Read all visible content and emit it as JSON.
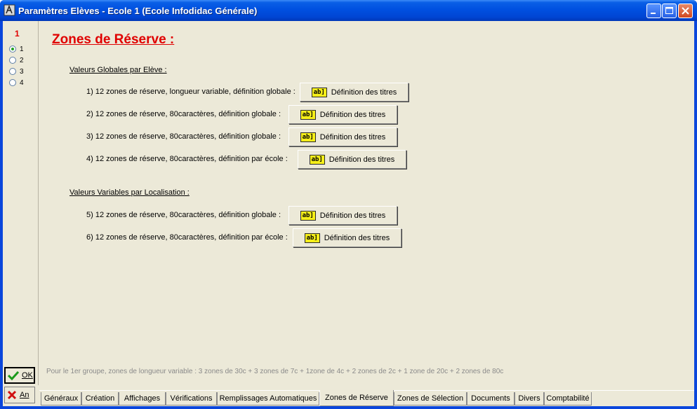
{
  "window": {
    "title": "Paramètres Elèves - Ecole 1 (Ecole Infodidac Générale)"
  },
  "left": {
    "group_number": "1",
    "radios": [
      {
        "label": "1",
        "checked": true
      },
      {
        "label": "2",
        "checked": false
      },
      {
        "label": "3",
        "checked": false
      },
      {
        "label": "4",
        "checked": false
      }
    ],
    "ok_label": "OK",
    "cancel_label": "An"
  },
  "main": {
    "heading": "Zones de Réserve :",
    "section_global": "Valeurs Globales par Elève :",
    "section_local": "Valeurs Variables par Localisation :",
    "rows": [
      {
        "label": "1) 12 zones de réserve, longueur variable, définition globale :",
        "button": "Définition des titres"
      },
      {
        "label": "2) 12 zones de réserve, 80caractères, définition globale :",
        "button": "Définition des titres"
      },
      {
        "label": "3) 12 zones de réserve, 80caractères, définition globale :",
        "button": "Définition des titres"
      },
      {
        "label": "4) 12 zones de réserve, 80caractères, définition par école :",
        "button": "Définition des titres"
      },
      {
        "label": "5) 12 zones de réserve, 80caractères, définition globale :",
        "button": "Définition des titres"
      },
      {
        "label": "6) 12 zones de réserve, 80caractères, définition par école :",
        "button": "Définition des titres"
      }
    ],
    "button_icon_text": "ab]",
    "note": "Pour le 1er groupe, zones de longueur variable : 3 zones de 30c + 3 zones de 7c + 1zone de 4c + 2 zones de 2c + 1 zone de 20c + 2 zones de 80c"
  },
  "tabs": [
    {
      "label": "Généraux",
      "active": false
    },
    {
      "label": "Création",
      "active": false
    },
    {
      "label": "Affichages",
      "active": false
    },
    {
      "label": "Vérifications",
      "active": false
    },
    {
      "label": "Remplissages Automatiques",
      "active": false
    },
    {
      "label": "Zones de Réserve",
      "active": true
    },
    {
      "label": "Zones de Sélection",
      "active": false
    },
    {
      "label": "Documents",
      "active": false
    },
    {
      "label": "Divers",
      "active": false
    },
    {
      "label": "Comptabilité",
      "active": false
    }
  ],
  "colors": {
    "accent_red": "#e00000",
    "titlebar": "#0050e0",
    "face": "#ece9d8"
  }
}
